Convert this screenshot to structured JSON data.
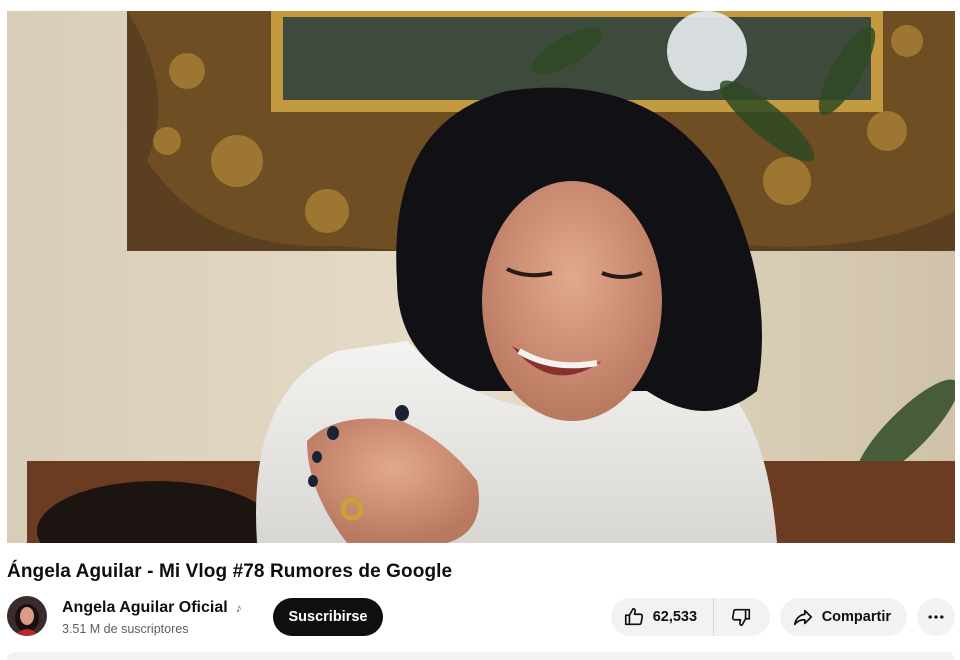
{
  "video": {
    "title": "Ángela Aguilar - Mi Vlog #78 Rumores de Google"
  },
  "channel": {
    "name": "Angela Aguilar Oficial",
    "subscribers": "3.51 M de suscriptores",
    "badge_icon": "music-note-icon"
  },
  "buttons": {
    "subscribe_label": "Suscribirse",
    "like_count": "62,533",
    "share_label": "Compartir",
    "more_label": "···"
  },
  "colors": {
    "subscribe_bg": "#0f0f0f",
    "pill_bg": "#f2f2f2"
  }
}
